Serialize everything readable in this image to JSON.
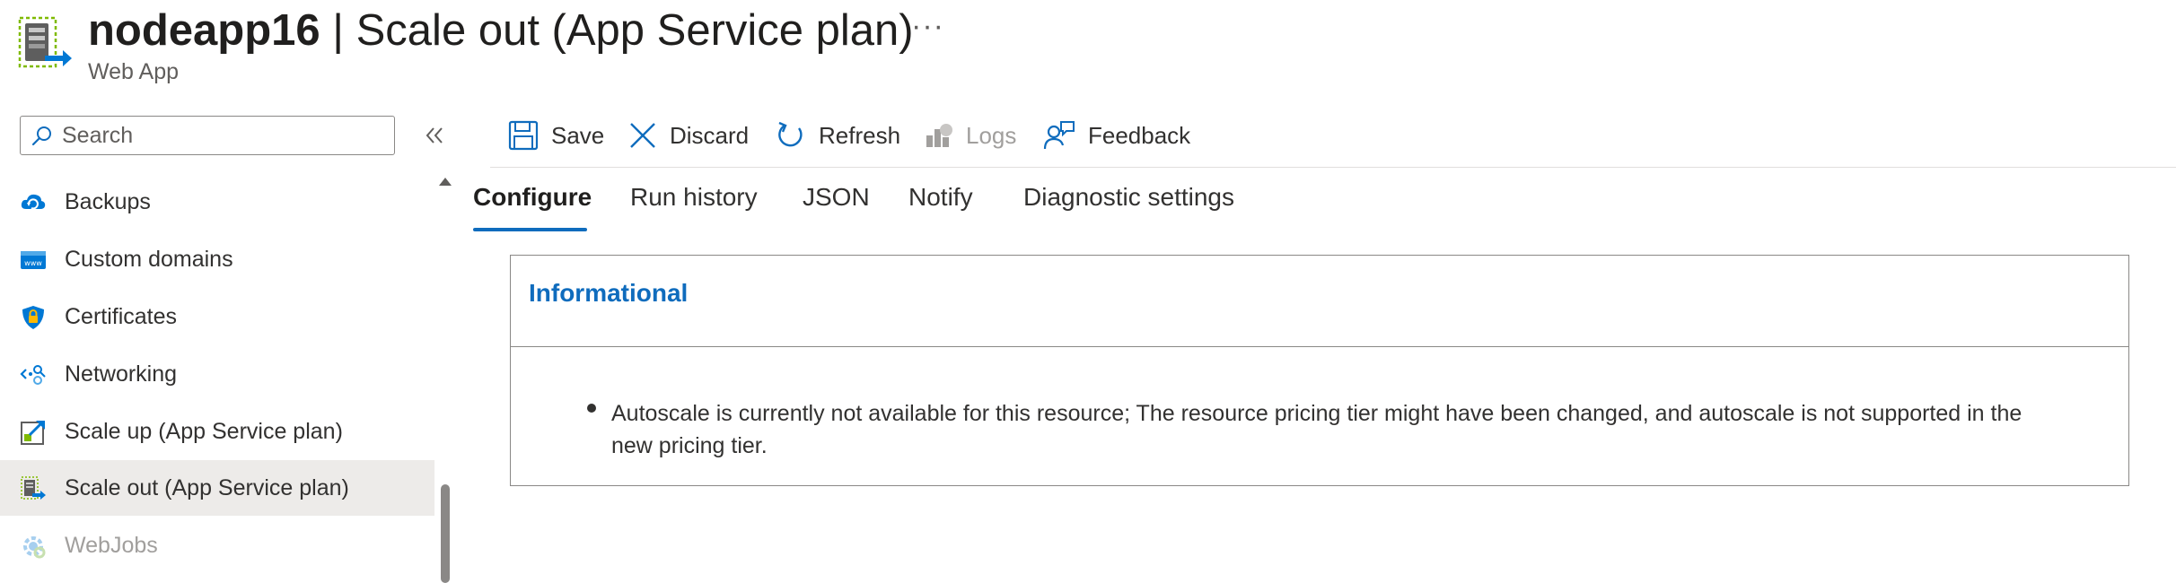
{
  "header": {
    "resource_name": "nodeapp16",
    "title_rest": " | Scale out (App Service plan)",
    "subtitle": "Web App",
    "more_label": "···"
  },
  "search": {
    "placeholder": "Search"
  },
  "sidebar": {
    "collapse_label": "«",
    "items": [
      {
        "label": "Backups",
        "icon": "cloud-backup-icon"
      },
      {
        "label": "Custom domains",
        "icon": "www-icon"
      },
      {
        "label": "Certificates",
        "icon": "shield-lock-icon"
      },
      {
        "label": "Networking",
        "icon": "network-icon"
      },
      {
        "label": "Scale up (App Service plan)",
        "icon": "scale-up-icon"
      },
      {
        "label": "Scale out (App Service plan)",
        "icon": "scale-out-icon",
        "selected": true
      },
      {
        "label": "WebJobs",
        "icon": "webjobs-icon",
        "disabled": true
      }
    ]
  },
  "toolbar": {
    "save": "Save",
    "discard": "Discard",
    "refresh": "Refresh",
    "logs": "Logs",
    "feedback": "Feedback"
  },
  "tabs": [
    {
      "label": "Configure",
      "active": true
    },
    {
      "label": "Run history"
    },
    {
      "label": "JSON"
    },
    {
      "label": "Notify"
    },
    {
      "label": "Diagnostic settings"
    }
  ],
  "info": {
    "title": "Informational",
    "message": "Autoscale is currently not available for this resource; The resource pricing tier might have been changed, and autoscale is not supported in the new pricing tier."
  },
  "colors": {
    "accent": "#0f6cbd",
    "selected_bg": "#edebe9",
    "disabled_text": "#a19f9d"
  }
}
